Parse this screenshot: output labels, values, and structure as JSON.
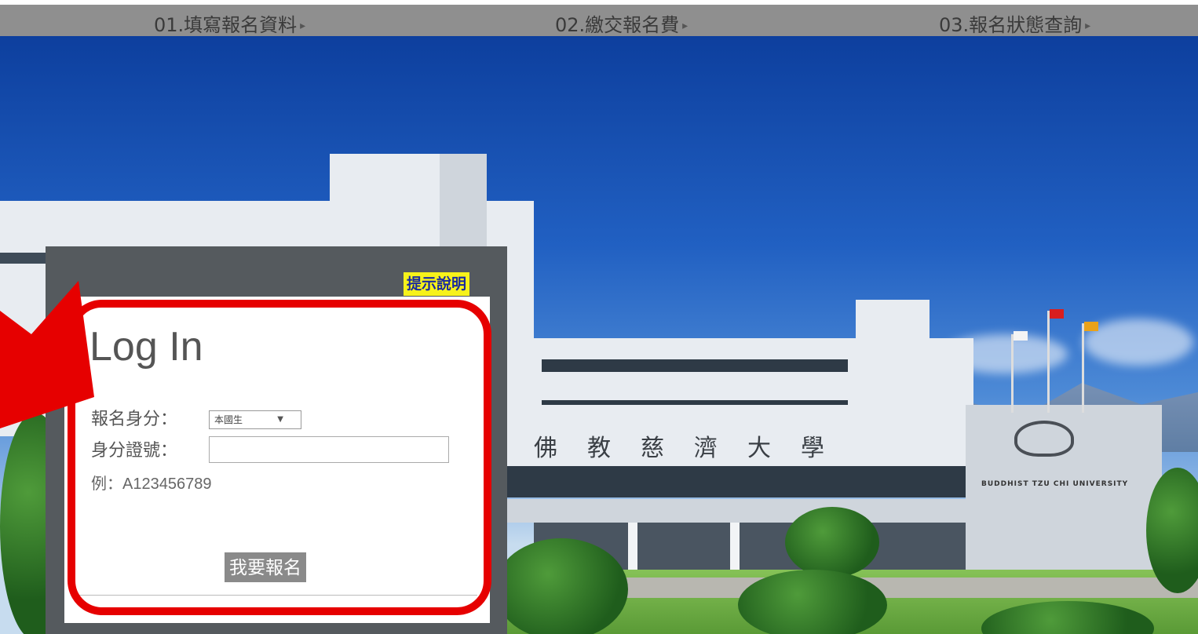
{
  "nav": {
    "items": [
      {
        "label": "01.填寫報名資料",
        "marker": "▸"
      },
      {
        "label": "02.繳交報名費",
        "marker": "▸"
      },
      {
        "label": "03.報名狀態查詢",
        "marker": "▸"
      }
    ]
  },
  "help": {
    "label": "提示說明"
  },
  "login": {
    "title": "Log In",
    "identity_label": "報名身分：",
    "identity_selected": "本國生",
    "id_label": "身分證號：",
    "id_value": "",
    "id_placeholder": "",
    "example": "例：A123456789",
    "submit_label": "我要報名"
  },
  "scene": {
    "sign_text": "佛教慈濟大學",
    "english_sign": "BUDDHIST  TZU CHI  UNIVERSITY"
  },
  "colors": {
    "nav_bg": "#8f8f8f",
    "highlight": "#e60000",
    "help_bg": "#f7f21a",
    "button_bg": "#8a8a8a"
  },
  "icons": [
    "dropdown-arrow-icon",
    "nav-arrow-icon",
    "pointer-arrow-icon"
  ]
}
